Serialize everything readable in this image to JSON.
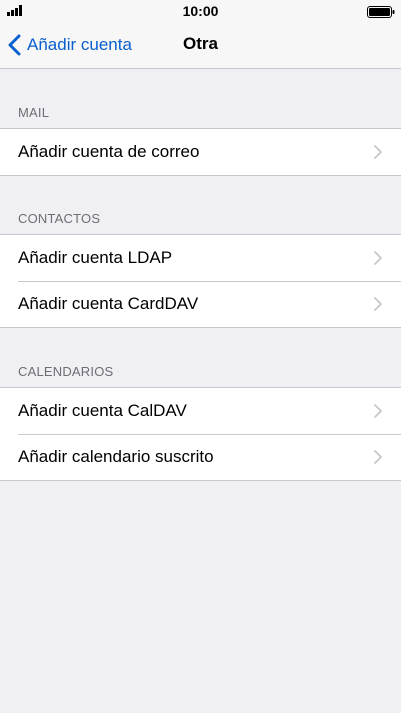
{
  "status_bar": {
    "time": "10:00",
    "signal_icon": "signal-bars-icon",
    "battery_icon": "battery-icon"
  },
  "nav": {
    "back_label": "Añadir cuenta",
    "back_icon": "chevron-left-icon",
    "title": "Otra",
    "accent_color": "#0a5fce"
  },
  "sections": {
    "mail": {
      "header": "MAIL",
      "rows": [
        "Añadir cuenta de correo"
      ]
    },
    "contacts": {
      "header": "CONTACTOS",
      "rows": [
        "Añadir cuenta LDAP",
        "Añadir cuenta CardDAV"
      ]
    },
    "calendars": {
      "header": "CALENDARIOS",
      "rows": [
        "Añadir cuenta CalDAV",
        "Añadir calendario suscrito"
      ]
    }
  },
  "row_icon": "chevron-right-icon"
}
